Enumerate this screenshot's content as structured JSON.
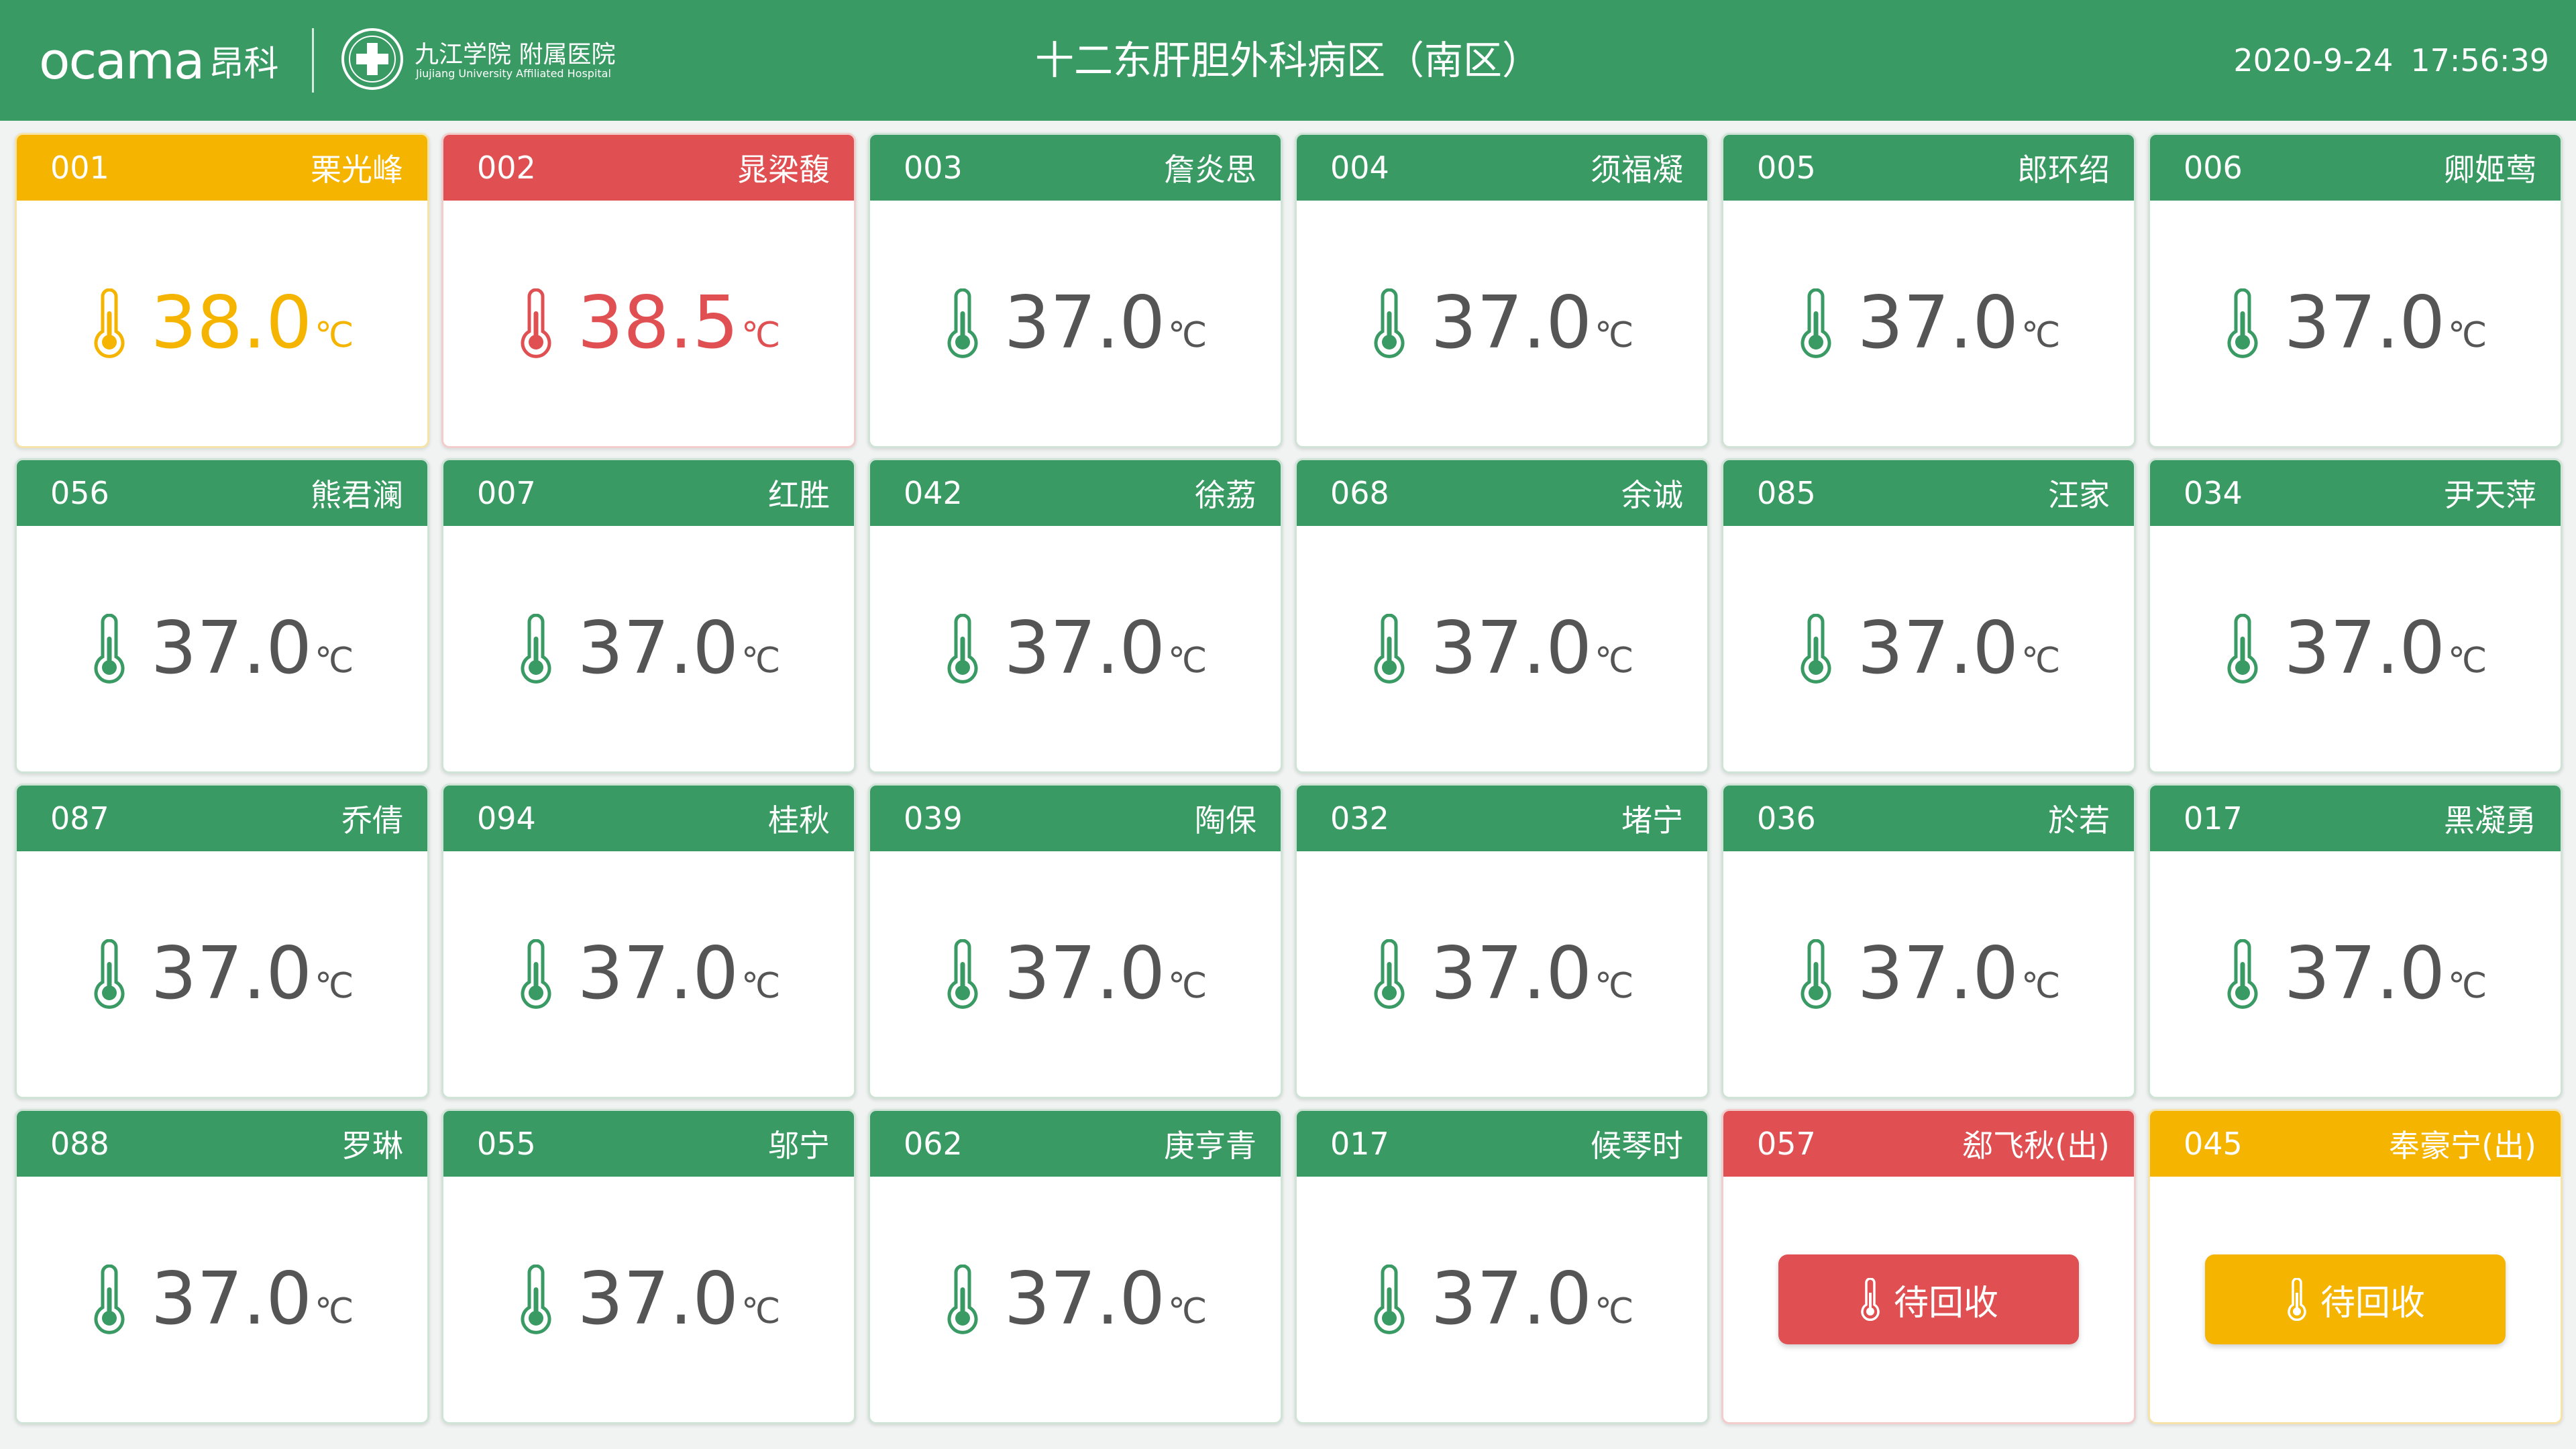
{
  "header": {
    "brand": "ocama",
    "brand_cn": "昂科",
    "hospital_name": "九江学院 附属医院",
    "hospital_name_en": "Jiujiang University Affiliated Hospital",
    "title": "十二东肝胆外科病区（南区）",
    "date": "2020-9-24",
    "time": "17:56:39"
  },
  "colors": {
    "normal": "#3a9a64",
    "warning": "#f5b400",
    "alert": "#e05052"
  },
  "beds": [
    {
      "id": "001",
      "name": "栗光峰",
      "temp": "38.0",
      "unit": "℃",
      "status": "warn"
    },
    {
      "id": "002",
      "name": "晁梁馥",
      "temp": "38.5",
      "unit": "℃",
      "status": "alert"
    },
    {
      "id": "003",
      "name": "詹炎思",
      "temp": "37.0",
      "unit": "℃",
      "status": "normal"
    },
    {
      "id": "004",
      "name": "须福凝",
      "temp": "37.0",
      "unit": "℃",
      "status": "normal"
    },
    {
      "id": "005",
      "name": "郎环绍",
      "temp": "37.0",
      "unit": "℃",
      "status": "normal"
    },
    {
      "id": "006",
      "name": "卿姬莺",
      "temp": "37.0",
      "unit": "℃",
      "status": "normal"
    },
    {
      "id": "056",
      "name": "熊君澜",
      "temp": "37.0",
      "unit": "℃",
      "status": "normal"
    },
    {
      "id": "007",
      "name": "红胜",
      "temp": "37.0",
      "unit": "℃",
      "status": "normal"
    },
    {
      "id": "042",
      "name": "徐荔",
      "temp": "37.0",
      "unit": "℃",
      "status": "normal"
    },
    {
      "id": "068",
      "name": "余诚",
      "temp": "37.0",
      "unit": "℃",
      "status": "normal"
    },
    {
      "id": "085",
      "name": "汪家",
      "temp": "37.0",
      "unit": "℃",
      "status": "normal"
    },
    {
      "id": "034",
      "name": "尹天萍",
      "temp": "37.0",
      "unit": "℃",
      "status": "normal"
    },
    {
      "id": "087",
      "name": "乔倩",
      "temp": "37.0",
      "unit": "℃",
      "status": "normal"
    },
    {
      "id": "094",
      "name": "桂秋",
      "temp": "37.0",
      "unit": "℃",
      "status": "normal"
    },
    {
      "id": "039",
      "name": "陶保",
      "temp": "37.0",
      "unit": "℃",
      "status": "normal"
    },
    {
      "id": "032",
      "name": "堵宁",
      "temp": "37.0",
      "unit": "℃",
      "status": "normal"
    },
    {
      "id": "036",
      "name": "於若",
      "temp": "37.0",
      "unit": "℃",
      "status": "normal"
    },
    {
      "id": "017",
      "name": "黑凝勇",
      "temp": "37.0",
      "unit": "℃",
      "status": "normal"
    },
    {
      "id": "088",
      "name": "罗琳",
      "temp": "37.0",
      "unit": "℃",
      "status": "normal"
    },
    {
      "id": "055",
      "name": "邬宁",
      "temp": "37.0",
      "unit": "℃",
      "status": "normal"
    },
    {
      "id": "062",
      "name": "庚亨青",
      "temp": "37.0",
      "unit": "℃",
      "status": "normal"
    },
    {
      "id": "017",
      "name": "候琴时",
      "temp": "37.0",
      "unit": "℃",
      "status": "normal"
    },
    {
      "id": "057",
      "name": "郄飞秋(出)",
      "status": "alert",
      "action": "待回收"
    },
    {
      "id": "045",
      "name": "奉豪宁(出)",
      "status": "warn",
      "action": "待回收"
    }
  ]
}
